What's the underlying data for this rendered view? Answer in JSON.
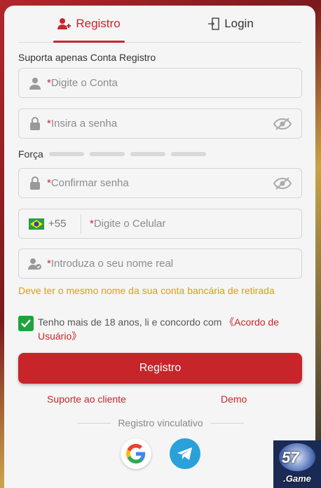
{
  "tabs": {
    "register": "Registro",
    "login": "Login"
  },
  "subtitle": "Suporta apenas Conta Registro",
  "fields": {
    "account": {
      "req": "*",
      "placeholder": "Digite o Conta"
    },
    "password": {
      "req": "*",
      "placeholder": "Insira a senha"
    },
    "confirm": {
      "req": "*",
      "placeholder": "Confirmar senha"
    },
    "phone": {
      "country_code": "+55",
      "req": "*",
      "placeholder": "Digite o Celular"
    },
    "realname": {
      "req": "*",
      "placeholder": "Introduza o seu nome real"
    }
  },
  "strength_label": "Força",
  "note": "Deve ter o mesmo nome da sua conta bancária de retirada",
  "agree": {
    "text": "Tenho mais de 18 anos, li e concordo com ",
    "link": "《Acordo de Usuário》",
    "checked": true
  },
  "submit": "Registro",
  "support": "Suporte ao cliente",
  "demo": "Demo",
  "divider": "Registro vinculativo",
  "logo": {
    "num": "57",
    "name": ".Game"
  },
  "colors": {
    "accent": "#c8252b",
    "warning": "#e0a000",
    "check": "#1fa33a",
    "telegram": "#2aa1da"
  },
  "icons": [
    "add-user-icon",
    "login-door-icon",
    "user-icon",
    "lock-icon",
    "eye-off-icon",
    "brazil-flag-icon",
    "user-verified-icon",
    "checkmark-icon",
    "google-icon",
    "telegram-icon"
  ]
}
